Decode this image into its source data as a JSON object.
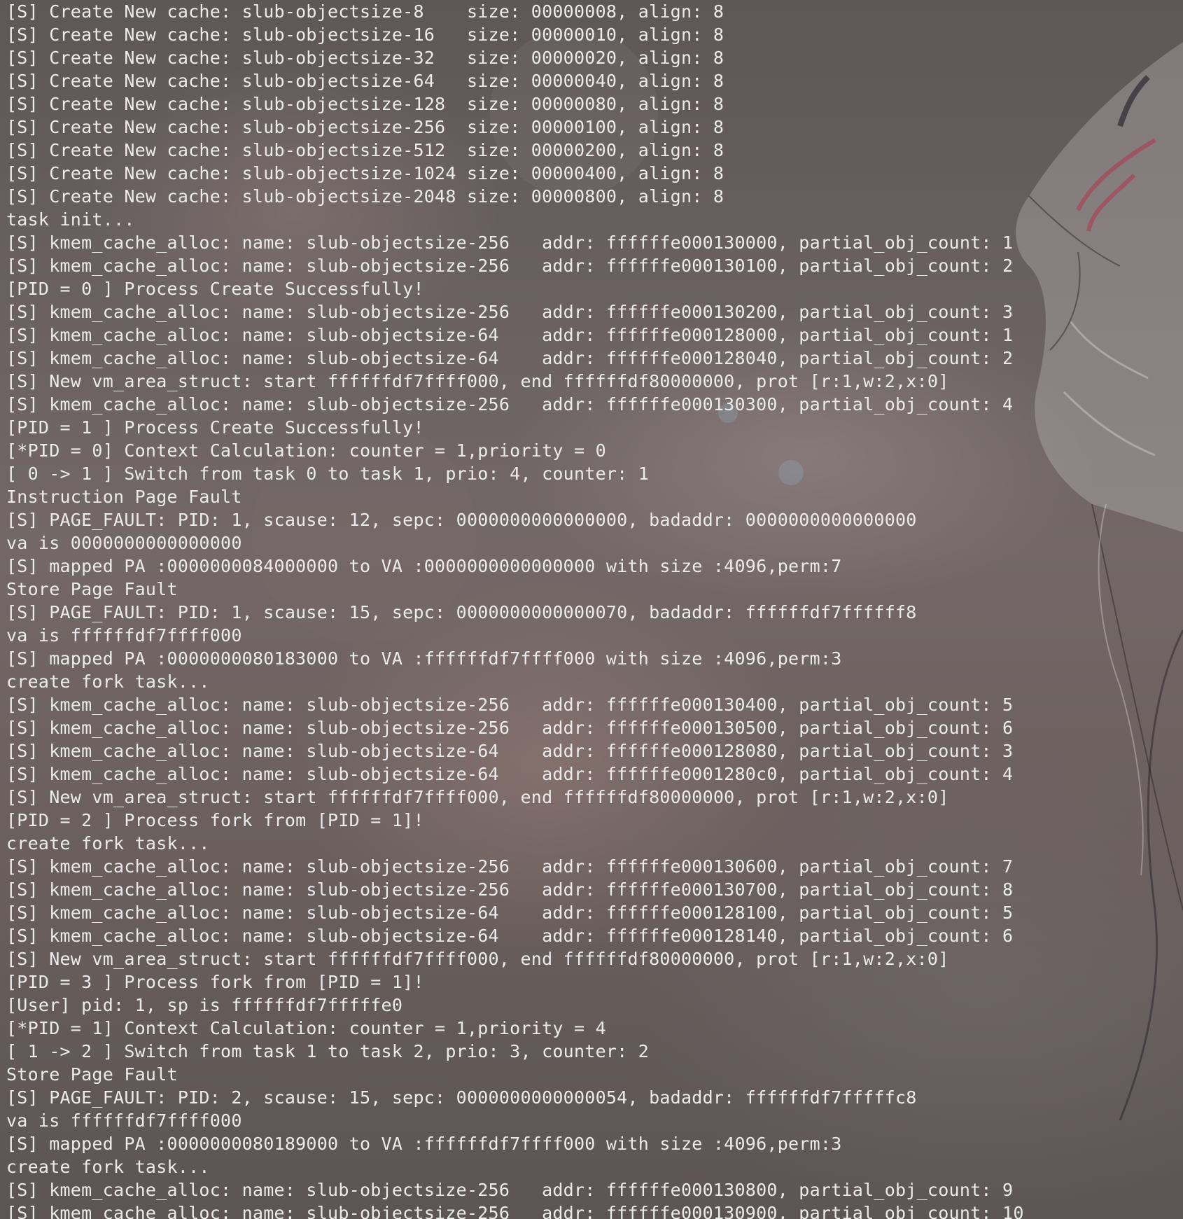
{
  "terminal": {
    "lines": [
      "[S] Create New cache: slub-objectsize-8    size: 00000008, align: 8",
      "[S] Create New cache: slub-objectsize-16   size: 00000010, align: 8",
      "[S] Create New cache: slub-objectsize-32   size: 00000020, align: 8",
      "[S] Create New cache: slub-objectsize-64   size: 00000040, align: 8",
      "[S] Create New cache: slub-objectsize-128  size: 00000080, align: 8",
      "[S] Create New cache: slub-objectsize-256  size: 00000100, align: 8",
      "[S] Create New cache: slub-objectsize-512  size: 00000200, align: 8",
      "[S] Create New cache: slub-objectsize-1024 size: 00000400, align: 8",
      "[S] Create New cache: slub-objectsize-2048 size: 00000800, align: 8",
      "task init...",
      "[S] kmem_cache_alloc: name: slub-objectsize-256   addr: ffffffe000130000, partial_obj_count: 1",
      "[S] kmem_cache_alloc: name: slub-objectsize-256   addr: ffffffe000130100, partial_obj_count: 2",
      "[PID = 0 ] Process Create Successfully!",
      "[S] kmem_cache_alloc: name: slub-objectsize-256   addr: ffffffe000130200, partial_obj_count: 3",
      "[S] kmem_cache_alloc: name: slub-objectsize-64    addr: ffffffe000128000, partial_obj_count: 1",
      "[S] kmem_cache_alloc: name: slub-objectsize-64    addr: ffffffe000128040, partial_obj_count: 2",
      "[S] New vm_area_struct: start ffffffdf7ffff000, end ffffffdf80000000, prot [r:1,w:2,x:0]",
      "[S] kmem_cache_alloc: name: slub-objectsize-256   addr: ffffffe000130300, partial_obj_count: 4",
      "[PID = 1 ] Process Create Successfully!",
      "[*PID = 0] Context Calculation: counter = 1,priority = 0",
      "[ 0 -> 1 ] Switch from task 0 to task 1, prio: 4, counter: 1",
      "Instruction Page Fault",
      "[S] PAGE_FAULT: PID: 1, scause: 12, sepc: 0000000000000000, badaddr: 0000000000000000",
      "va is 0000000000000000",
      "[S] mapped PA :0000000084000000 to VA :0000000000000000 with size :4096,perm:7",
      "Store Page Fault",
      "[S] PAGE_FAULT: PID: 1, scause: 15, sepc: 0000000000000070, badaddr: ffffffdf7ffffff8",
      "va is ffffffdf7ffff000",
      "[S] mapped PA :0000000080183000 to VA :ffffffdf7ffff000 with size :4096,perm:3",
      "create fork task...",
      "[S] kmem_cache_alloc: name: slub-objectsize-256   addr: ffffffe000130400, partial_obj_count: 5",
      "[S] kmem_cache_alloc: name: slub-objectsize-256   addr: ffffffe000130500, partial_obj_count: 6",
      "[S] kmem_cache_alloc: name: slub-objectsize-64    addr: ffffffe000128080, partial_obj_count: 3",
      "[S] kmem_cache_alloc: name: slub-objectsize-64    addr: ffffffe0001280c0, partial_obj_count: 4",
      "[S] New vm_area_struct: start ffffffdf7ffff000, end ffffffdf80000000, prot [r:1,w:2,x:0]",
      "[PID = 2 ] Process fork from [PID = 1]!",
      "create fork task...",
      "[S] kmem_cache_alloc: name: slub-objectsize-256   addr: ffffffe000130600, partial_obj_count: 7",
      "[S] kmem_cache_alloc: name: slub-objectsize-256   addr: ffffffe000130700, partial_obj_count: 8",
      "[S] kmem_cache_alloc: name: slub-objectsize-64    addr: ffffffe000128100, partial_obj_count: 5",
      "[S] kmem_cache_alloc: name: slub-objectsize-64    addr: ffffffe000128140, partial_obj_count: 6",
      "[S] New vm_area_struct: start ffffffdf7ffff000, end ffffffdf80000000, prot [r:1,w:2,x:0]",
      "[PID = 3 ] Process fork from [PID = 1]!",
      "[User] pid: 1, sp is ffffffdf7fffffe0",
      "[*PID = 1] Context Calculation: counter = 1,priority = 4",
      "[ 1 -> 2 ] Switch from task 1 to task 2, prio: 3, counter: 2",
      "Store Page Fault",
      "[S] PAGE_FAULT: PID: 2, scause: 15, sepc: 0000000000000054, badaddr: ffffffdf7fffffc8",
      "va is ffffffdf7ffff000",
      "[S] mapped PA :0000000080189000 to VA :ffffffdf7ffff000 with size :4096,perm:3",
      "create fork task...",
      "[S] kmem_cache_alloc: name: slub-objectsize-256   addr: ffffffe000130800, partial_obj_count: 9",
      "[S] kmem_cache_alloc: name: slub-objectsize-256   addr: ffffffe000130900, partial_obj_count: 10"
    ]
  },
  "colors": {
    "text": "#ecebeb",
    "background": "#6a5f5d"
  }
}
